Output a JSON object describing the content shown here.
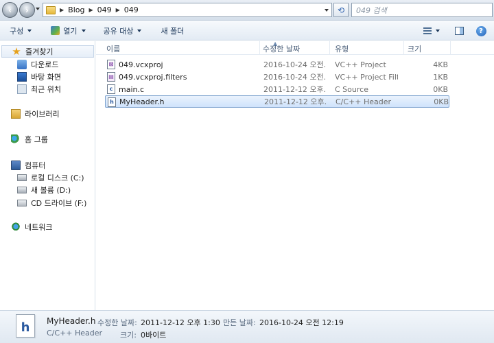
{
  "address": {
    "crumbs": [
      "Blog",
      "049",
      "049"
    ],
    "search_placeholder": "049 검색"
  },
  "toolbar": {
    "organize": "구성",
    "open": "열기",
    "share": "공유 대상",
    "new_folder": "새 폴더"
  },
  "sidebar": {
    "favorites": "즐겨찾기",
    "downloads": "다운로드",
    "desktop": "바탕 화면",
    "recent": "최근 위치",
    "libraries": "라이브러리",
    "homegroup": "홈 그룹",
    "computer": "컴퓨터",
    "local_disk": "로컬 디스크 (C:)",
    "new_volume": "새 볼륨 (D:)",
    "cd_drive": "CD 드라이브 (F:)",
    "network": "네트워크"
  },
  "columns": {
    "name": "이름",
    "date": "수정한 날짜",
    "type": "유형",
    "size": "크기"
  },
  "files": [
    {
      "name": "049.vcxproj",
      "date": "2016-10-24 오전...",
      "type": "VC++ Project",
      "size": "4KB"
    },
    {
      "name": "049.vcxproj.filters",
      "date": "2016-10-24 오전...",
      "type": "VC++ Project Filt...",
      "size": "1KB"
    },
    {
      "name": "main.c",
      "date": "2011-12-12 오후...",
      "type": "C Source",
      "size": "0KB"
    },
    {
      "name": "MyHeader.h",
      "date": "2011-12-12 오후...",
      "type": "C/C++ Header",
      "size": "0KB"
    }
  ],
  "details": {
    "filename": "MyHeader.h",
    "filetype": "C/C++ Header",
    "modified_label": "수정한 날짜:",
    "modified_value": "2011-12-12 오후 1:30",
    "created_label": "만든 날짜:",
    "created_value": "2016-10-24 오전 12:19",
    "size_label": "크기:",
    "size_value": "0바이트"
  }
}
